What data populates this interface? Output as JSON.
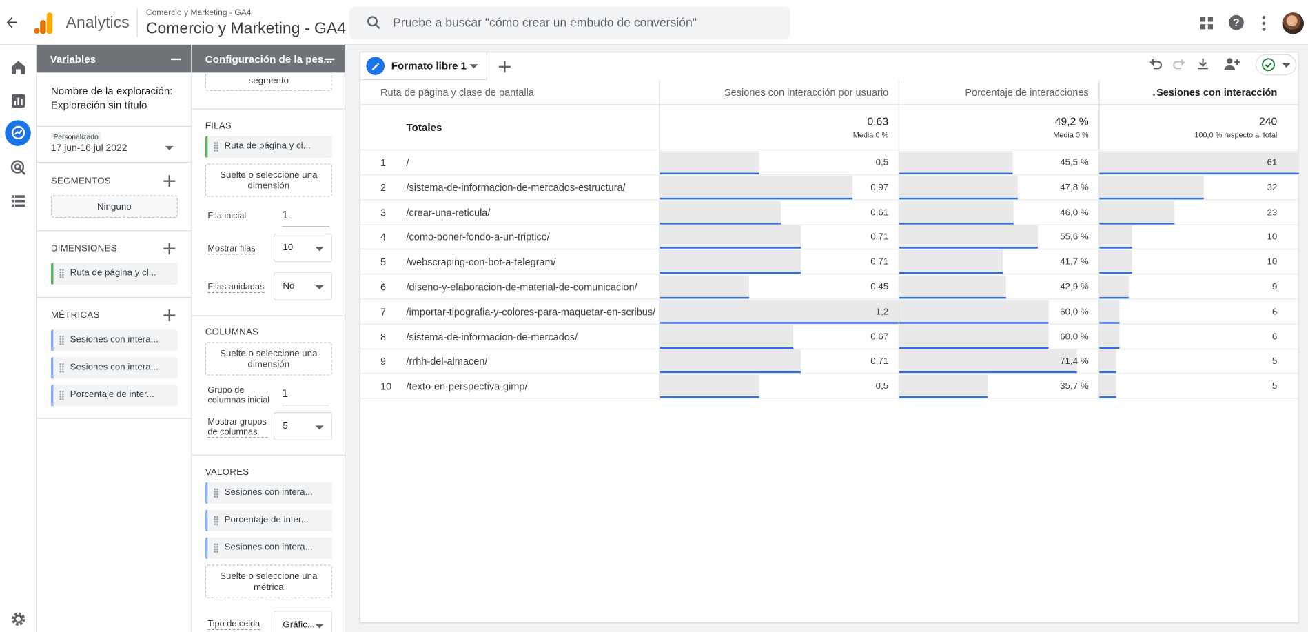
{
  "header": {
    "brand": "Analytics",
    "property_small": "Comercio y Marketing - GA4",
    "property_big": "Comercio y Marketing - GA4",
    "search_placeholder": "Pruebe a buscar \"cómo crear un embudo de conversión\""
  },
  "variables_panel": {
    "title": "Variables",
    "exploration_label": "Nombre de la exploración:",
    "exploration_name": "Exploración sin título",
    "date_tag": "Personalizado",
    "date_range": "17 jun-16 jul 2022",
    "segments_title": "SEGMENTOS",
    "segments_none": "Ninguno",
    "dimensions_title": "DIMENSIONES",
    "dimensions": [
      "Ruta de página y cl..."
    ],
    "metrics_title": "MÉTRICAS",
    "metrics": [
      "Sesiones con intera...",
      "Sesiones con intera...",
      "Porcentaje de inter..."
    ]
  },
  "settings_panel": {
    "title": "Configuración de la pes...",
    "segment_drop": "segmento",
    "rows_title": "FILAS",
    "rows_chip": "Ruta de página y cl...",
    "rows_drop": "Suelte o seleccione una dimensión",
    "start_row_label": "Fila inicial",
    "start_row_value": "1",
    "show_rows_label": "Mostrar filas",
    "show_rows_value": "10",
    "nested_rows_label": "Filas anidadas",
    "nested_rows_value": "No",
    "columns_title": "COLUMNAS",
    "columns_drop": "Suelte o seleccione una dimensión",
    "col_group_label": "Grupo de columnas inicial",
    "col_group_value": "1",
    "show_col_groups_label": "Mostrar grupos de columnas",
    "show_col_groups_value": "5",
    "values_title": "VALORES",
    "values": [
      "Sesiones con intera...",
      "Porcentaje de inter...",
      "Sesiones con intera..."
    ],
    "values_drop": "Suelte o seleccione una métrica",
    "cell_type_label": "Tipo de celda",
    "cell_type_value": "Gráfic..."
  },
  "tab": {
    "name": "Formato libre 1"
  },
  "table": {
    "col_dim": "Ruta de página y clase de pantalla",
    "col_m1": "Sesiones con interacción por usuario",
    "col_m2": "Porcentaje de interacciones",
    "col_m3": "↓Sesiones con interacción",
    "totals_label": "Totales",
    "totals": {
      "m1": "0,63",
      "m1_sub": "Media 0 %",
      "m2": "49,2 %",
      "m2_sub": "Media 0 %",
      "m3": "240",
      "m3_sub": "100,0 % respecto al total"
    },
    "rows": [
      {
        "idx": "1",
        "path": "/",
        "m1": "0,5",
        "m2": "45,5 %",
        "m3": "61",
        "v1": 0.5,
        "v2": 45.5,
        "v3": 61
      },
      {
        "idx": "2",
        "path": "/sistema-de-informacion-de-mercados-estructura/",
        "m1": "0,97",
        "m2": "47,8 %",
        "m3": "32",
        "v1": 0.97,
        "v2": 47.8,
        "v3": 32
      },
      {
        "idx": "3",
        "path": "/crear-una-reticula/",
        "m1": "0,61",
        "m2": "46,0 %",
        "m3": "23",
        "v1": 0.61,
        "v2": 46.0,
        "v3": 23
      },
      {
        "idx": "4",
        "path": "/como-poner-fondo-a-un-triptico/",
        "m1": "0,71",
        "m2": "55,6 %",
        "m3": "10",
        "v1": 0.71,
        "v2": 55.6,
        "v3": 10
      },
      {
        "idx": "5",
        "path": "/webscraping-con-bot-a-telegram/",
        "m1": "0,71",
        "m2": "41,7 %",
        "m3": "10",
        "v1": 0.71,
        "v2": 41.7,
        "v3": 10
      },
      {
        "idx": "6",
        "path": "/diseno-y-elaboracion-de-material-de-comunicacion/",
        "m1": "0,45",
        "m2": "42,9 %",
        "m3": "9",
        "v1": 0.45,
        "v2": 42.9,
        "v3": 9
      },
      {
        "idx": "7",
        "path": "/importar-tipografia-y-colores-para-maquetar-en-scribus/",
        "m1": "1,2",
        "m2": "60,0 %",
        "m3": "6",
        "v1": 1.2,
        "v2": 60.0,
        "v3": 6
      },
      {
        "idx": "8",
        "path": "/sistema-de-informacion-de-mercados/",
        "m1": "0,67",
        "m2": "60,0 %",
        "m3": "6",
        "v1": 0.67,
        "v2": 60.0,
        "v3": 6
      },
      {
        "idx": "9",
        "path": "/rrhh-del-almacen/",
        "m1": "0,71",
        "m2": "71,4 %",
        "m3": "5",
        "v1": 0.71,
        "v2": 71.4,
        "v3": 5
      },
      {
        "idx": "10",
        "path": "/texto-en-perspectiva-gimp/",
        "m1": "0,5",
        "m2": "35,7 %",
        "m3": "5",
        "v1": 0.5,
        "v2": 35.7,
        "v3": 5
      }
    ]
  },
  "colors": {
    "accent": "#1a73e8",
    "bar_fill": "#e9e9e9",
    "bar_line": "#2f6fde",
    "dimension_chip": "#5fae5a",
    "metric_chip": "#8ab4f8"
  }
}
